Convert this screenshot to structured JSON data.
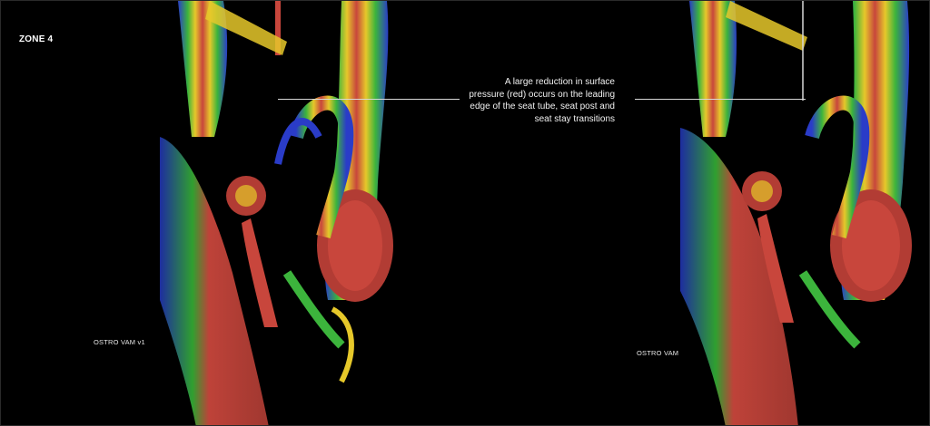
{
  "zone_title": "ZONE 4",
  "callout_lines": [
    "A large reduction in surface",
    "pressure (red) occurs on the leading",
    "edge of the seat tube, seat post and",
    "seat stay transitions"
  ],
  "left_model_label": "OSTRO VAM v1",
  "right_model_label": "OSTRO VAM",
  "colors": {
    "background": "#000000",
    "high_pressure": "#c8463c",
    "mid_pressure": "#e6c82a",
    "low_pressure": "#2a3cc8",
    "transition": "#3cb43c"
  }
}
